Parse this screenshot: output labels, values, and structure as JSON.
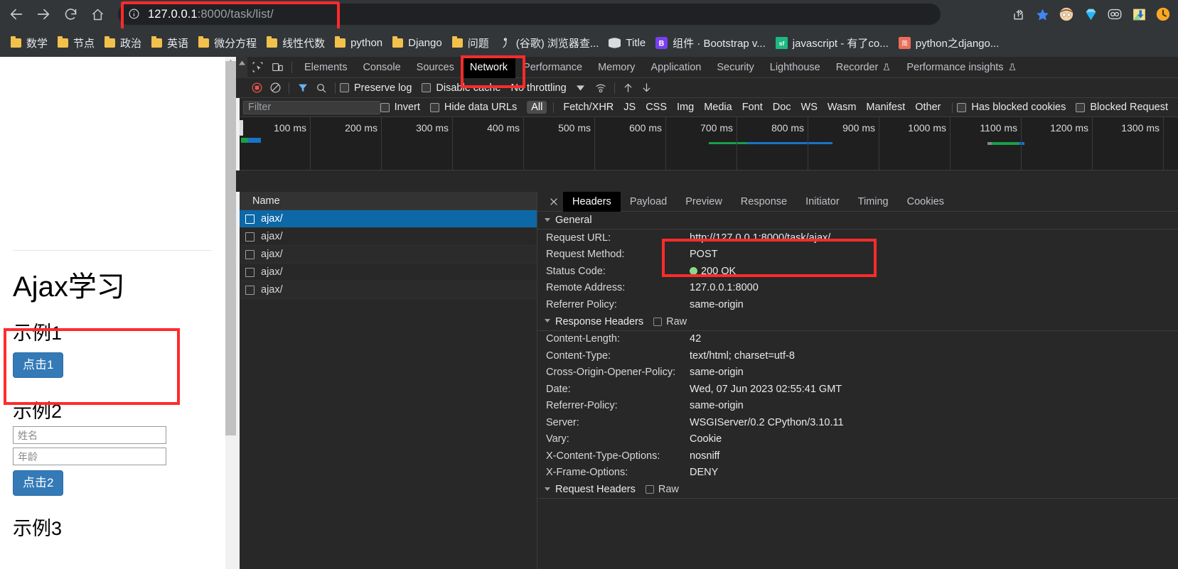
{
  "browser": {
    "nav": {
      "back": "back-arrow",
      "forward": "forward-arrow",
      "reload": "reload",
      "home": "home"
    },
    "omnibox": {
      "info_icon": "info-circle-icon",
      "host": "127.0.0.1",
      "rest": ":8000/task/list/",
      "full_url": "127.0.0.1:8000/task/list/"
    },
    "actions": [
      "share-icon",
      "bookmark-star-icon",
      "profile-avatar-icon",
      "diamond-extension-icon",
      "goo-extension-icon",
      "download-extension-icon",
      "clock-extension-icon"
    ],
    "bookmarks": [
      {
        "label": "数学",
        "icon": "folder-icon"
      },
      {
        "label": "节点",
        "icon": "folder-icon"
      },
      {
        "label": "政治",
        "icon": "folder-icon"
      },
      {
        "label": "英语",
        "icon": "folder-icon"
      },
      {
        "label": "微分方程",
        "icon": "folder-icon"
      },
      {
        "label": "线性代数",
        "icon": "folder-icon"
      },
      {
        "label": "python",
        "icon": "folder-icon"
      },
      {
        "label": "Django",
        "icon": "folder-icon"
      },
      {
        "label": "问题",
        "icon": "folder-icon"
      },
      {
        "label": "(谷歌) 浏览器查...",
        "icon": "site-icon"
      },
      {
        "label": "Title",
        "icon": "globe-icon"
      },
      {
        "label": "组件 · Bootstrap v...",
        "icon": "bootstrap-b-icon"
      },
      {
        "label": "javascript - 有了co...",
        "icon": "sf-icon"
      },
      {
        "label": "python之django...",
        "icon": "jian-icon"
      }
    ]
  },
  "page": {
    "title": "Ajax学习",
    "example1": {
      "heading": "示例1",
      "button": "点击1"
    },
    "example2": {
      "heading": "示例2",
      "name_placeholder": "姓名",
      "age_placeholder": "年龄",
      "name_value": "",
      "age_value": "",
      "button": "点击2"
    },
    "example3": {
      "heading": "示例3"
    }
  },
  "devtools": {
    "panel_tabs": [
      {
        "label": "Elements",
        "active": false
      },
      {
        "label": "Console",
        "active": false
      },
      {
        "label": "Sources",
        "active": false
      },
      {
        "label": "Network",
        "active": true
      },
      {
        "label": "Performance",
        "active": false
      },
      {
        "label": "Memory",
        "active": false
      },
      {
        "label": "Application",
        "active": false
      },
      {
        "label": "Security",
        "active": false
      },
      {
        "label": "Lighthouse",
        "active": false
      },
      {
        "label": "Recorder",
        "active": false,
        "flask": true
      },
      {
        "label": "Performance insights",
        "active": false,
        "flask": true
      }
    ],
    "toolbar": {
      "record_icon": "record-stop-icon",
      "clear_icon": "clear-no-entry-icon",
      "filter_icon": "funnel-filter-icon",
      "search_icon": "search-magnifier-icon",
      "preserve_log": "Preserve log",
      "preserve_log_checked": false,
      "disable_cache": "Disable cache",
      "disable_cache_checked": false,
      "throttling": "No throttling",
      "network_conditions_icon": "wifi-settings-icon",
      "import_icon": "upload-arrow-icon",
      "export_icon": "download-arrow-icon"
    },
    "filterbar": {
      "placeholder": "Filter",
      "value": "",
      "invert": "Invert",
      "invert_checked": false,
      "hide_data_urls": "Hide data URLs",
      "hide_data_urls_checked": false,
      "types": [
        "All",
        "Fetch/XHR",
        "JS",
        "CSS",
        "Img",
        "Media",
        "Font",
        "Doc",
        "WS",
        "Wasm",
        "Manifest",
        "Other"
      ],
      "active_type": "All",
      "has_blocked_cookies": "Has blocked cookies",
      "has_blocked_cookies_checked": false,
      "blocked_requests": "Blocked Request",
      "blocked_requests_checked": false
    },
    "overview": {
      "ticks": [
        "100 ms",
        "200 ms",
        "300 ms",
        "400 ms",
        "500 ms",
        "600 ms",
        "700 ms",
        "800 ms",
        "900 ms",
        "1000 ms",
        "1100 ms",
        "1200 ms",
        "1300 ms"
      ]
    },
    "requests": {
      "column_header": "Name",
      "rows": [
        {
          "name": "ajax/",
          "selected": true
        },
        {
          "name": "ajax/",
          "selected": false
        },
        {
          "name": "ajax/",
          "selected": false
        },
        {
          "name": "ajax/",
          "selected": false
        },
        {
          "name": "ajax/",
          "selected": false
        }
      ]
    },
    "detail": {
      "close_icon": "close-x-icon",
      "tabs": [
        {
          "label": "Headers",
          "active": true
        },
        {
          "label": "Payload",
          "active": false
        },
        {
          "label": "Preview",
          "active": false
        },
        {
          "label": "Response",
          "active": false
        },
        {
          "label": "Initiator",
          "active": false
        },
        {
          "label": "Timing",
          "active": false
        },
        {
          "label": "Cookies",
          "active": false
        }
      ],
      "general": {
        "title": "General",
        "rows": [
          {
            "key": "Request URL:",
            "value": "http://127.0.0.1:8000/task/ajax/"
          },
          {
            "key": "Request Method:",
            "value": "POST"
          },
          {
            "key": "Status Code:",
            "value": "200 OK",
            "status_dot": "#8ad98a"
          },
          {
            "key": "Remote Address:",
            "value": "127.0.0.1:8000"
          },
          {
            "key": "Referrer Policy:",
            "value": "same-origin"
          }
        ]
      },
      "response_headers": {
        "title": "Response Headers",
        "raw_label": "Raw",
        "raw_checked": false,
        "rows": [
          {
            "key": "Content-Length:",
            "value": "42"
          },
          {
            "key": "Content-Type:",
            "value": "text/html; charset=utf-8"
          },
          {
            "key": "Cross-Origin-Opener-Policy:",
            "value": "same-origin"
          },
          {
            "key": "Date:",
            "value": "Wed, 07 Jun 2023 02:55:41 GMT"
          },
          {
            "key": "Referrer-Policy:",
            "value": "same-origin"
          },
          {
            "key": "Server:",
            "value": "WSGIServer/0.2 CPython/3.10.11"
          },
          {
            "key": "Vary:",
            "value": "Cookie"
          },
          {
            "key": "X-Content-Type-Options:",
            "value": "nosniff"
          },
          {
            "key": "X-Frame-Options:",
            "value": "DENY"
          }
        ]
      },
      "request_headers": {
        "title": "Request Headers",
        "raw_label": "Raw",
        "raw_checked": false
      }
    }
  },
  "annotations": {
    "highlight_color": "#ff2b2b",
    "boxes": [
      "omnibox-url",
      "network-tab",
      "example1-block",
      "request-url-method"
    ]
  }
}
